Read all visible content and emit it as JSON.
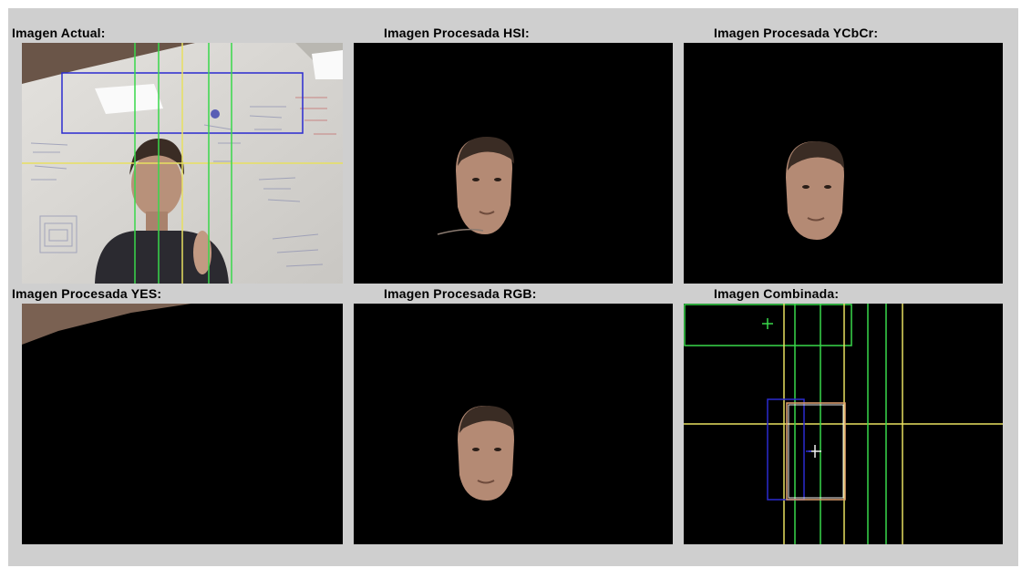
{
  "window": {
    "background": "#cfcfcf"
  },
  "panels": [
    {
      "id": "actual",
      "label": "Imagen Actual:"
    },
    {
      "id": "hsi",
      "label": "Imagen Procesada HSI:"
    },
    {
      "id": "ycbcr",
      "label": "Imagen Procesada YCbCr:"
    },
    {
      "id": "yes",
      "label": "Imagen Procesada YES:"
    },
    {
      "id": "rgb",
      "label": "Imagen Procesada RGB:"
    },
    {
      "id": "combinada",
      "label": "Imagen Combinada:"
    }
  ],
  "colors": {
    "tracking_green": "#39d84a",
    "tracking_yellow": "#e8e060",
    "tracking_blue": "#2b2bd0",
    "tracking_orange": "#e0a070",
    "skin": "#b88a74",
    "hair": "#3a2c24"
  }
}
